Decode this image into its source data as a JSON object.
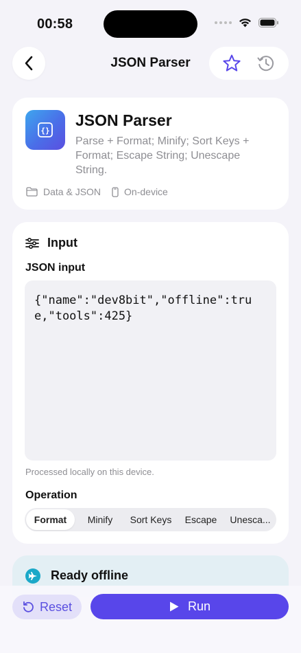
{
  "status": {
    "time": "00:58"
  },
  "nav": {
    "title": "JSON Parser"
  },
  "tool": {
    "name": "JSON Parser",
    "description": "Parse + Format; Minify; Sort Keys + Format; Escape String; Unescape String.",
    "category": "Data & JSON",
    "mode": "On-device",
    "icon_glyph": "{}"
  },
  "input_section": {
    "title": "Input",
    "field_label": "JSON input",
    "value": "{\"name\":\"dev8bit\",\"offline\":true,\"tools\":425}",
    "hint": "Processed locally on this device.",
    "operation_label": "Operation",
    "operations": [
      "Format",
      "Minify",
      "Sort Keys",
      "Escape",
      "Unesca..."
    ],
    "selected_operation": "Format"
  },
  "ready": {
    "title": "Ready offline"
  },
  "actions": {
    "reset_label": "Reset",
    "run_label": "Run"
  },
  "colors": {
    "accent": "#5846ea",
    "accent_soft": "#e3e0f9",
    "background": "#f4f3f9",
    "ready_bg": "#e3eff4"
  }
}
